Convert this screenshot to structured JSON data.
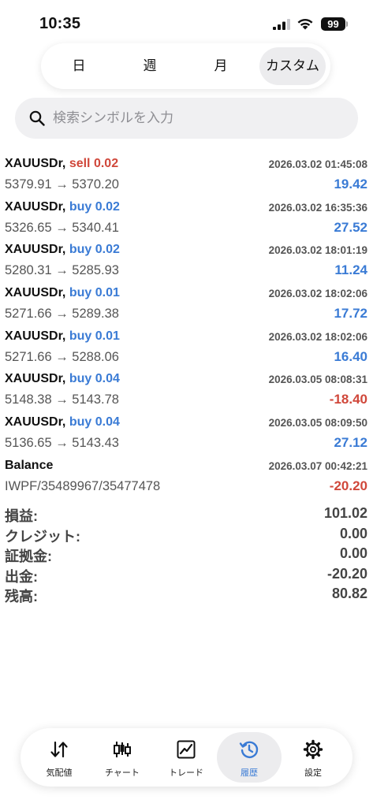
{
  "status_bar": {
    "time": "10:35",
    "battery": "99"
  },
  "period_tabs": [
    {
      "label": "日"
    },
    {
      "label": "週"
    },
    {
      "label": "月"
    },
    {
      "label": "カスタム",
      "active": true
    }
  ],
  "search": {
    "placeholder": "検索シンボルを入力",
    "value": ""
  },
  "colors": {
    "sell": "#d0473a",
    "buy": "#3a7bd5",
    "positive": "#3a7bd5",
    "negative": "#d0473a"
  },
  "deals": [
    {
      "symbol": "XAUUSDr,",
      "side": "sell",
      "volume": "0.02",
      "time": "2026.03.02 01:45:08",
      "prices": "5379.91 → 5370.20",
      "profit": "19.42",
      "positive": true
    },
    {
      "symbol": "XAUUSDr,",
      "side": "buy",
      "volume": "0.02",
      "time": "2026.03.02 16:35:36",
      "prices": "5326.65 → 5340.41",
      "profit": "27.52",
      "positive": true
    },
    {
      "symbol": "XAUUSDr,",
      "side": "buy",
      "volume": "0.02",
      "time": "2026.03.02 18:01:19",
      "prices": "5280.31 → 5285.93",
      "profit": "11.24",
      "positive": true
    },
    {
      "symbol": "XAUUSDr,",
      "side": "buy",
      "volume": "0.01",
      "time": "2026.03.02 18:02:06",
      "prices": "5271.66 → 5289.38",
      "profit": "17.72",
      "positive": true
    },
    {
      "symbol": "XAUUSDr,",
      "side": "buy",
      "volume": "0.01",
      "time": "2026.03.02 18:02:06",
      "prices": "5271.66 → 5288.06",
      "profit": "16.40",
      "positive": true
    },
    {
      "symbol": "XAUUSDr,",
      "side": "buy",
      "volume": "0.04",
      "time": "2026.03.05 08:08:31",
      "prices": "5148.38 → 5143.78",
      "profit": "-18.40",
      "positive": false
    },
    {
      "symbol": "XAUUSDr,",
      "side": "buy",
      "volume": "0.04",
      "time": "2026.03.05 08:09:50",
      "prices": "5136.65 → 5143.43",
      "profit": "27.12",
      "positive": true
    },
    {
      "symbol": "Balance",
      "side": "",
      "volume": "",
      "time": "2026.03.07 00:42:21",
      "prices": "IWPF/35489967/35477478",
      "profit": "-20.20",
      "positive": false
    }
  ],
  "summary": [
    {
      "label": "損益:",
      "value": "101.02"
    },
    {
      "label": "クレジット:",
      "value": "0.00"
    },
    {
      "label": "証拠金:",
      "value": "0.00"
    },
    {
      "label": "出金:",
      "value": "-20.20"
    },
    {
      "label": "残高:",
      "value": "80.82"
    }
  ],
  "nav": [
    {
      "label": "気配値",
      "icon": "quotes-arrows-icon"
    },
    {
      "label": "チャート",
      "icon": "candlestick-chart-icon"
    },
    {
      "label": "トレード",
      "icon": "trade-chart-icon"
    },
    {
      "label": "履歴",
      "icon": "history-clock-icon",
      "active": true
    },
    {
      "label": "設定",
      "icon": "gear-icon"
    }
  ]
}
